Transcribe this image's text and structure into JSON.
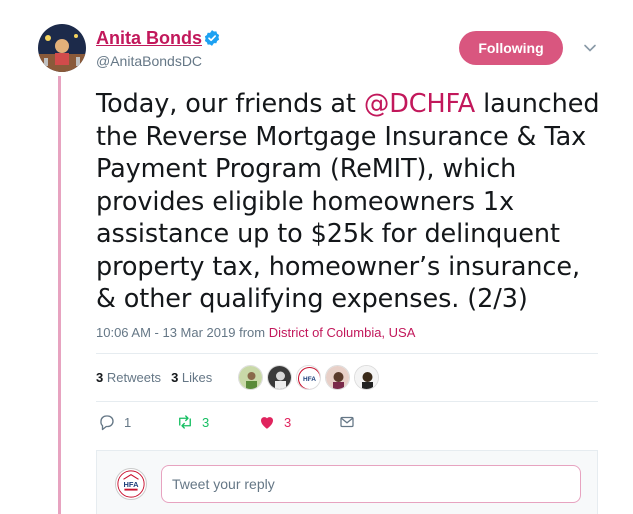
{
  "author": {
    "name": "Anita Bonds",
    "handle": "@AnitaBondsDC"
  },
  "follow_button": {
    "label": "Following"
  },
  "tweet": {
    "text_before_mention": "Today, our friends at ",
    "mention": "@DCHFA",
    "text_after_mention": " launched the Reverse Mortgage Insurance & Tax Payment Program (ReMIT), which provides eligible homeowners 1x assistance up to $25k for delinquent property tax, homeowner’s insurance, & other qualifying expenses. (2/3)"
  },
  "meta": {
    "timestamp": "10:06 AM - 13 Mar 2019",
    "from_label": "from",
    "location": "District of Columbia, USA"
  },
  "stats": {
    "retweets_count": "3",
    "retweets_label": "Retweets",
    "likes_count": "3",
    "likes_label": "Likes"
  },
  "likers": [
    "liker-1",
    "liker-2",
    "liker-hfa",
    "liker-4",
    "liker-5"
  ],
  "actions": {
    "reply_count": "1",
    "retweet_count": "3",
    "like_count": "3"
  },
  "reply": {
    "placeholder": "Tweet your reply",
    "avatar_text": "HFA"
  },
  "colors": {
    "accent": "#c2185b",
    "follow_button": "#d9567f",
    "retweet_green": "#17bf63",
    "like_red": "#e0245e",
    "thread_line": "#e7a3c0"
  },
  "icons": {
    "verified": "verified-badge-icon",
    "chevron": "chevron-down-icon",
    "reply": "reply-icon",
    "retweet": "retweet-icon",
    "like": "heart-icon",
    "dm": "envelope-icon"
  }
}
